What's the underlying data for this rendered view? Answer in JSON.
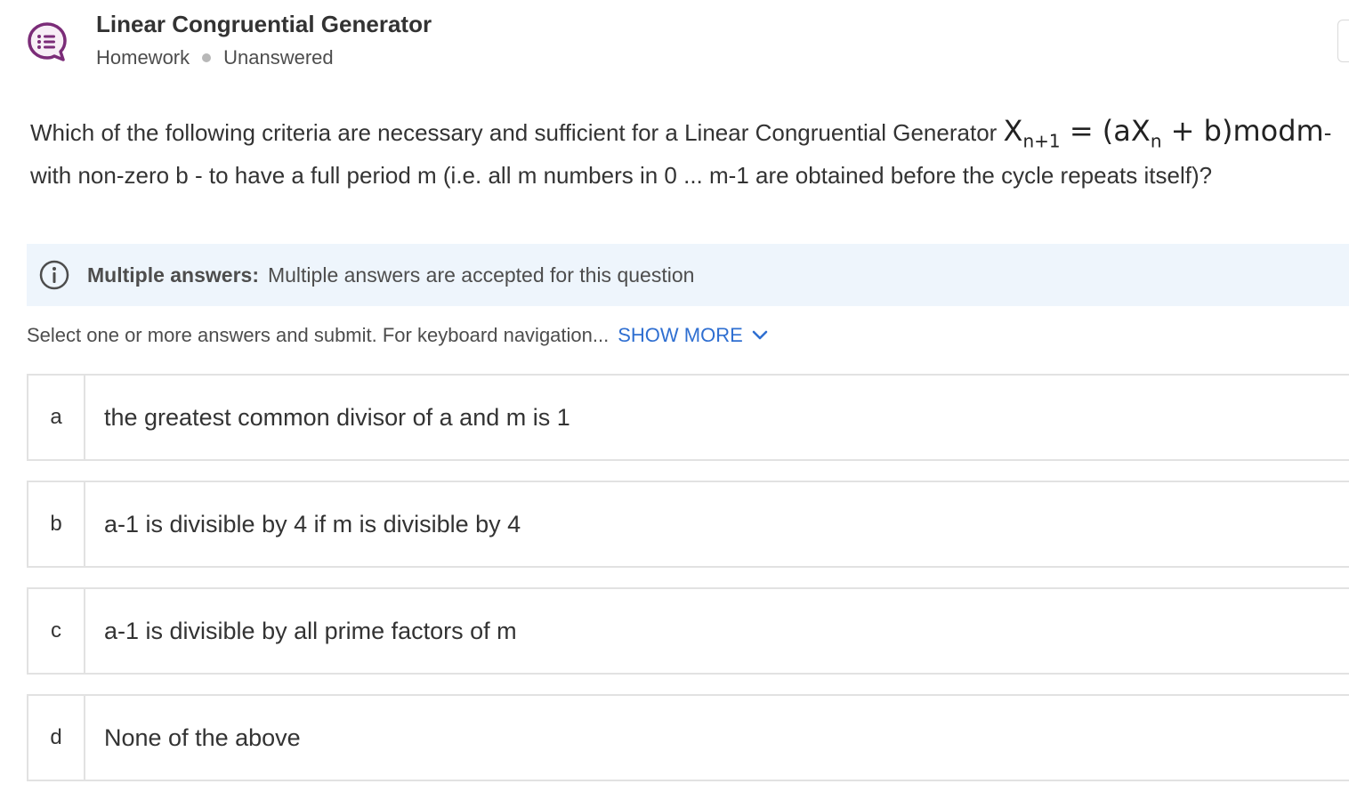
{
  "header": {
    "title": "Linear Congruential Generator",
    "category": "Homework",
    "status": "Unanswered",
    "icon": "question-bubble-icon",
    "accent_color": "#7b2c78"
  },
  "question": {
    "text_before": "Which of the following criteria are necessary and sufficient for a Linear Congruential Generator ",
    "math": {
      "lhs_var": "X",
      "lhs_sub": "n+1",
      "equals": " = ",
      "rhs_open": "(aX",
      "rhs_sub": "n",
      "rhs_close": " + b)modm"
    },
    "text_after_math": "-",
    "line2": "with non-zero b - to have a full period m (i.e. all m numbers in 0 ... m-1 are obtained before the cycle repeats itself)?"
  },
  "info": {
    "icon": "info-icon",
    "title": "Multiple answers:",
    "text": "Multiple answers are accepted for this question",
    "background_color": "#eef5fc"
  },
  "instructions": {
    "text": "Select one or more answers and submit. For keyboard navigation...",
    "show_more_label": "SHOW MORE",
    "link_color": "#2f6fd1"
  },
  "options": [
    {
      "letter": "a",
      "text": "the greatest common divisor of a and m is 1"
    },
    {
      "letter": "b",
      "text": "a-1 is divisible by 4 if m is divisible by 4"
    },
    {
      "letter": "c",
      "text": "a-1 is divisible by all prime factors of m"
    },
    {
      "letter": "d",
      "text": "None of the above"
    }
  ]
}
